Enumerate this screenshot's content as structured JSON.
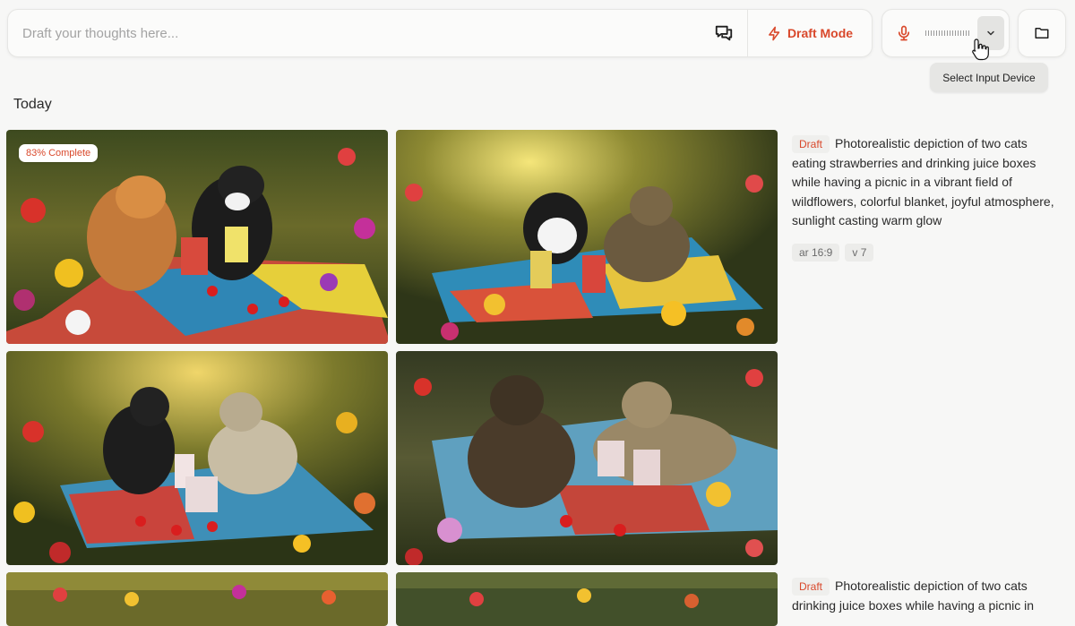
{
  "prompt_bar": {
    "placeholder": "Draft your thoughts here...",
    "draft_mode_label": "Draft Mode"
  },
  "voice": {
    "tooltip": "Select Input Device"
  },
  "feed": {
    "section_title": "Today",
    "jobs": [
      {
        "tag": "Draft",
        "prompt": "Photorealistic depiction of two cats eating strawberries and drinking juice boxes while having a picnic in a vibrant field of wildflowers, colorful blanket, joyful atmosphere, sunlight casting warm glow",
        "params": [
          "ar 16:9",
          "v 7"
        ],
        "progress_label": "83% Complete"
      },
      {
        "tag": "Draft",
        "prompt": "Photorealistic depiction of two cats drinking juice boxes while having a picnic in"
      }
    ]
  },
  "colors": {
    "accent": "#d9482b",
    "background": "#f7f7f6",
    "panel": "#fbfbfa"
  },
  "icons": {
    "chat": "chat-bubbles-icon",
    "draft": "lightning-icon",
    "mic": "microphone-icon",
    "dropdown": "chevron-down-icon",
    "folder": "folder-icon"
  }
}
